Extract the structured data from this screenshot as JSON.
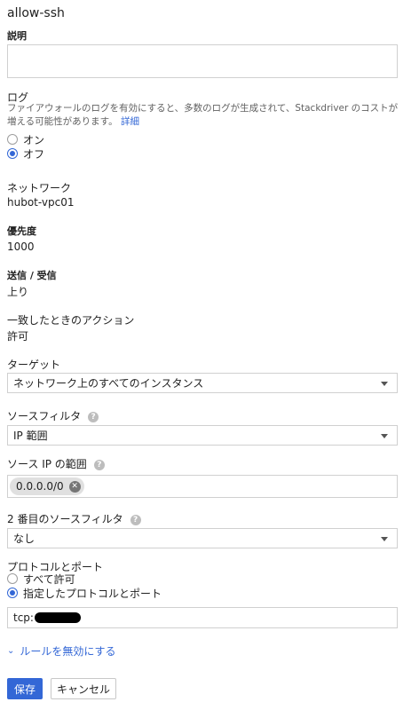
{
  "title": "allow-ssh",
  "description": {
    "label": "説明",
    "value": ""
  },
  "logs": {
    "label": "ログ",
    "help_text": "ファイアウォールのログを有効にすると、多数のログが生成されて、Stackdriver のコストが増える可能性があります。",
    "details_link": "詳細",
    "options": [
      {
        "label": "オン",
        "checked": false
      },
      {
        "label": "オフ",
        "checked": true
      }
    ]
  },
  "network": {
    "label": "ネットワーク",
    "value": "hubot-vpc01"
  },
  "priority": {
    "label": "優先度",
    "value": "1000"
  },
  "direction": {
    "label": "送信 / 受信",
    "value": "上り"
  },
  "action": {
    "label": "一致したときのアクション",
    "value": "許可"
  },
  "targets": {
    "label": "ターゲット",
    "value": "ネットワーク上のすべてのインスタンス"
  },
  "source_filter": {
    "label": "ソースフィルタ",
    "value": "IP 範囲"
  },
  "source_ip": {
    "label": "ソース IP の範囲",
    "chips": [
      "0.0.0.0/0"
    ]
  },
  "second_source_filter": {
    "label": "2 番目のソースフィルタ",
    "value": "なし"
  },
  "protocols": {
    "label": "プロトコルとポート",
    "options": [
      {
        "label": "すべて許可",
        "checked": false
      },
      {
        "label": "指定したプロトコルとポート",
        "checked": true
      }
    ],
    "value": "tcp:"
  },
  "disable_rule_link": "ルールを無効にする",
  "buttons": {
    "save": "保存",
    "cancel": "キャンセル"
  },
  "colors": {
    "accent": "#3367d6"
  }
}
